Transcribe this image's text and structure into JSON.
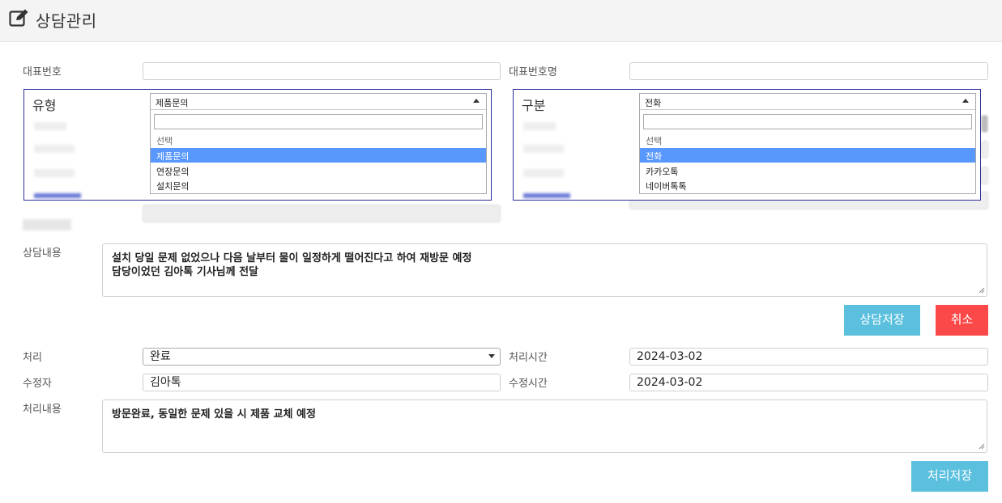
{
  "header": {
    "title": "상담관리",
    "icon": "edit-icon"
  },
  "form": {
    "rep_number_label": "대표번호",
    "rep_number_value": "",
    "rep_name_label": "대표번호명",
    "rep_name_value": "",
    "consult_content_label": "상담내용",
    "consult_content_value": "설치 당일 문제 없었으나 다음 날부터 물이 일정하게 떨어진다고 하여 재방문 예정\n담당이었던 김아톡 기사님께 전달",
    "save_consult_label": "상담저장",
    "cancel_label": "취소",
    "process_label": "처리",
    "process_value": "완료",
    "process_time_label": "처리시간",
    "process_time_value": "2024-03-02",
    "editor_label": "수정자",
    "editor_value": "김아톡",
    "edit_time_label": "수정시간",
    "edit_time_value": "2024-03-02",
    "process_content_label": "처리내용",
    "process_content_value": "방문완료, 동일한 문제 있을 시 제품 교체 예정",
    "save_process_label": "처리저장"
  },
  "type_dropdown": {
    "label": "유형",
    "selected": "제품문의",
    "search_value": "",
    "options": [
      "선택",
      "제품문의",
      "연장문의",
      "설치문의"
    ],
    "highlighted_index": 1
  },
  "category_dropdown": {
    "label": "구분",
    "selected": "전화",
    "search_value": "",
    "options": [
      "선택",
      "전화",
      "카카오톡",
      "네이버톡톡"
    ],
    "highlighted_index": 1
  },
  "colors": {
    "info": "#5bc0de",
    "danger": "#fb4848",
    "highlight": "#5897fb",
    "panel_border": "#2d2d9c"
  }
}
